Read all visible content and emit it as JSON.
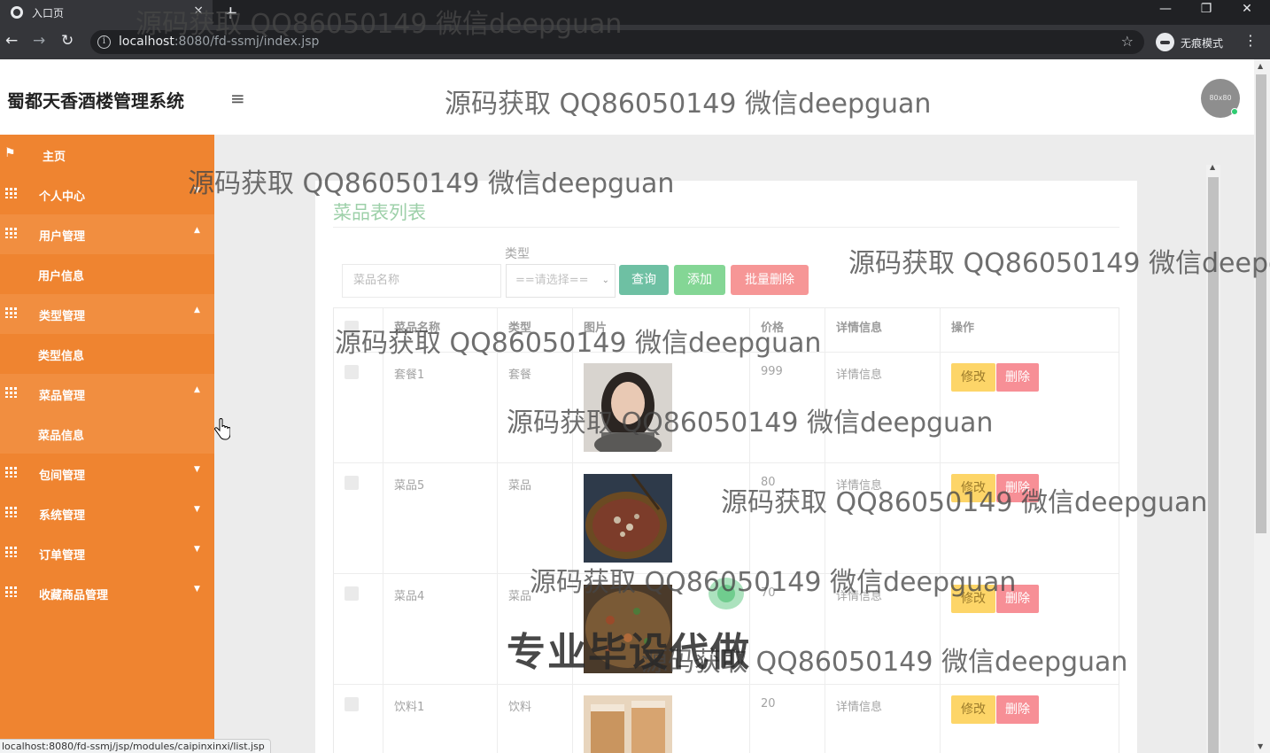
{
  "browser": {
    "tab_title": "入口页",
    "tab_close": "×",
    "new_tab": "+",
    "url_host": "localhost",
    "url_rest": ":8080/fd-ssmj/index.jsp",
    "incognito_label": "无痕模式",
    "status_url": "localhost:8080/fd-ssmj/jsp/modules/caipinxinxi/list.jsp"
  },
  "header": {
    "app_title": "蜀都天香酒楼管理系统",
    "avatar_text": "80x80"
  },
  "sidebar": {
    "items": [
      {
        "label": "主页"
      },
      {
        "label": "个人中心"
      },
      {
        "label": "用户管理"
      },
      {
        "label": "用户信息"
      },
      {
        "label": "类型管理"
      },
      {
        "label": "类型信息"
      },
      {
        "label": "菜品管理"
      },
      {
        "label": "菜品信息"
      },
      {
        "label": "包间管理"
      },
      {
        "label": "系统管理"
      },
      {
        "label": "订单管理"
      },
      {
        "label": "收藏商品管理"
      }
    ]
  },
  "main": {
    "title": "菜品表列表",
    "type_label": "类型",
    "search_placeholder": "菜品名称",
    "type_select_value": "==请选择==",
    "buttons": {
      "query": "查询",
      "add": "添加",
      "batch_delete": "批量删除"
    },
    "columns": [
      "菜品名称",
      "类型",
      "图片",
      "价格",
      "详情信息",
      "操作"
    ],
    "rows": [
      {
        "name": "套餐1",
        "type": "套餐",
        "price": "999",
        "detail": "详情信息",
        "edit": "修改",
        "delete": "删除"
      },
      {
        "name": "菜品5",
        "type": "菜品",
        "price": "80",
        "detail": "详情信息",
        "edit": "修改",
        "delete": "删除"
      },
      {
        "name": "菜品4",
        "type": "菜品",
        "price": "70",
        "detail": "详情信息",
        "edit": "修改",
        "delete": "删除"
      },
      {
        "name": "饮料1",
        "type": "饮料",
        "price": "20",
        "detail": "详情信息",
        "edit": "修改",
        "delete": "删除"
      }
    ]
  },
  "watermarks": {
    "text": "源码获取 QQ86050149 微信deepguan",
    "clipped_text": "源码获取 QQ86050149 微信deepg",
    "big": "专业毕设代做"
  },
  "colors": {
    "sidebar": "#ef8430",
    "title_green": "#9dd0a9",
    "edit_yellow": "#fdd568",
    "delete_pink": "#f78f96"
  }
}
